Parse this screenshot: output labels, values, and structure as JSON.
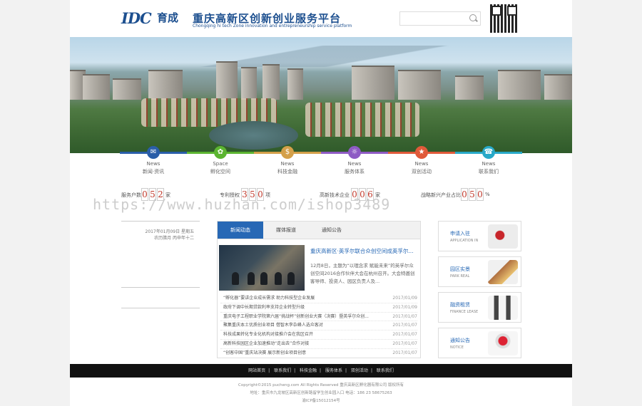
{
  "header": {
    "logo_idc": "IDC",
    "logo_yucheng": "育成",
    "title": "重庆高新区创新创业服务平台",
    "subtitle": "Chongqing hi tech Zone innovation and entrepreneurship service platform",
    "search_placeholder": ""
  },
  "nav": [
    {
      "en": "News",
      "cn": "新闻·资讯",
      "color": "#2a5ea8",
      "icon": "news-icon"
    },
    {
      "en": "Space",
      "cn": "孵化空间",
      "color": "#5cb531",
      "icon": "space-icon"
    },
    {
      "en": "News",
      "cn": "科技金融",
      "color": "#d4a04a",
      "icon": "finance-icon"
    },
    {
      "en": "News",
      "cn": "服务体系",
      "color": "#8e5bc4",
      "icon": "service-icon"
    },
    {
      "en": "News",
      "cn": "双创活动",
      "color": "#e05a3a",
      "icon": "activity-icon"
    },
    {
      "en": "News",
      "cn": "联系我们",
      "color": "#28a9c8",
      "icon": "contact-icon"
    }
  ],
  "stats": [
    {
      "label": "服务户数",
      "digits": [
        "0",
        "5",
        "2"
      ],
      "unit": "家"
    },
    {
      "label": "专利授权",
      "digits": [
        "3",
        "5",
        "0"
      ],
      "unit": "项"
    },
    {
      "label": "高新技术企业",
      "digits": [
        "0",
        "0",
        "6"
      ],
      "unit": "家"
    },
    {
      "label": "战略新兴产业占比",
      "digits": [
        "0",
        "5",
        "0"
      ],
      "unit": "%"
    }
  ],
  "watermark": "https://www.huzhan.com/ishop3489",
  "date": {
    "line1": "2017年01月09日 星期五",
    "line2": "农历腊月 丙申年十二"
  },
  "news": {
    "tabs": [
      "新闻动态",
      "媒体报道",
      "通知公告"
    ],
    "featured_title": "重庆高新区·英孚尔联合众创空间成英孚尔...",
    "featured_desc": "12月8日，主题为“以理念求 赋能未来”的英孚尔众创空间2016合作伙伴大会在杭州召开。大会特邀创客导师、投资人、园区负责人及...",
    "items": [
      {
        "text": "“孵化器”要讲企业成长需求 助力科技型企业发展",
        "date": "2017/01/09"
      },
      {
        "text": "政府下调中长期贷款利率支持企业转型升级",
        "date": "2017/01/09"
      },
      {
        "text": "重庆电子工程职业学院第六届“挑战杯”创新创业大赛（决赛）暨英孚尔众创...",
        "date": "2017/01/07"
      },
      {
        "text": "聚集重庆本土优质创业项目 借智木李杂峰人选众客对",
        "date": "2017/01/07"
      },
      {
        "text": "科技成果转化专业化机构对接推介会在我区召开",
        "date": "2017/01/07"
      },
      {
        "text": "高新科技园区企业加速推动“走出去”合作对接",
        "date": "2017/01/07"
      },
      {
        "text": "“创客中国”重庆站决赛 展示新创业项目创意",
        "date": "2017/01/07"
      }
    ]
  },
  "side": [
    {
      "title": "申请入驻",
      "en": "APPLICATION IN",
      "icon": "application-icon"
    },
    {
      "title": "园区实景",
      "en": "PARK REAL",
      "icon": "park-icon"
    },
    {
      "title": "融资租赁",
      "en": "FINANCE LEASE",
      "icon": "finance-lease-icon"
    },
    {
      "title": "通知公告",
      "en": "NOTICE",
      "icon": "notice-icon"
    }
  ],
  "footer": {
    "links": [
      "网站首页",
      "联系我们",
      "科技金融",
      "服务体系",
      "双创活动",
      "联系我们"
    ],
    "copyright": "Copyright©2015 pucheng.com All Rights Reserved 重庆高新区孵化器有限公司 版权所有",
    "address": "地址：重庆市九龙坡区高新区创新路留学生创业园入口 电话：186 23 58675263",
    "icp": "渝ICP备15012154号"
  },
  "colors": {
    "accent": "#2768b5",
    "footer_bg": "#111111",
    "digit": "#c0392b"
  }
}
